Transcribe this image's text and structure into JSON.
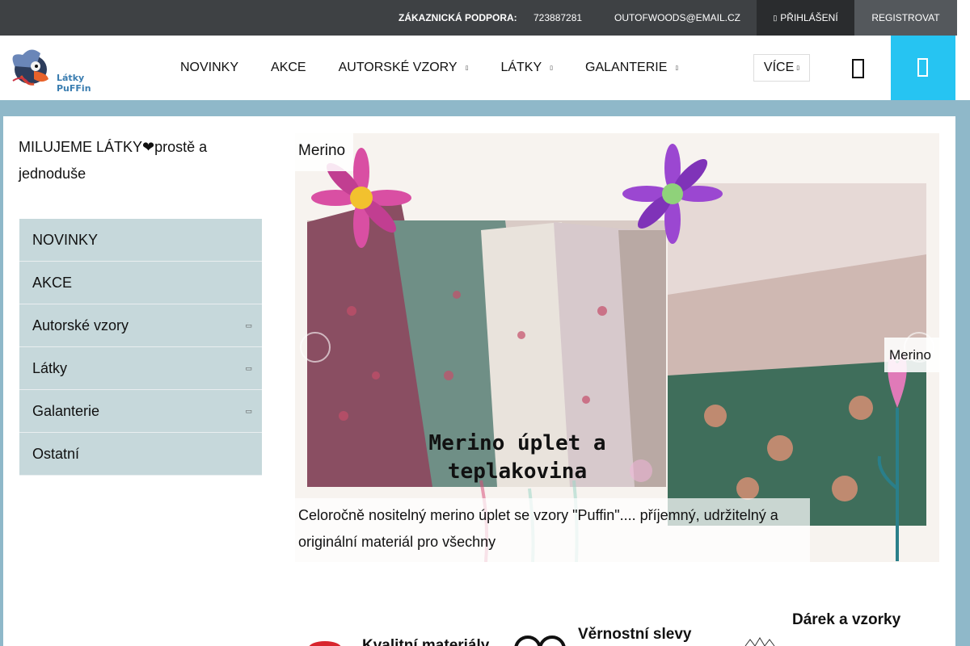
{
  "topbar": {
    "support_label": "ZÁKAZNICKÁ PODPORA:",
    "phone": "723887281",
    "email": "OUTOFWOODS@EMAIL.CZ",
    "login_label": "PŘIHLÁŠENÍ",
    "register_label": "REGISTROVAT"
  },
  "logo": {
    "text": "Látky PuFFin"
  },
  "nav": {
    "items": [
      {
        "label": "NOVINKY",
        "has_submenu": false
      },
      {
        "label": "AKCE",
        "has_submenu": false
      },
      {
        "label": "AUTORSKÉ VZORY",
        "has_submenu": true
      },
      {
        "label": "LÁTKY",
        "has_submenu": true
      },
      {
        "label": "GALANTERIE",
        "has_submenu": true
      }
    ],
    "more_label": "VÍCE"
  },
  "sidebar": {
    "welcome": "MILUJEME LÁTKY❤prostě a jednoduše",
    "items": [
      {
        "label": "NOVINKY"
      },
      {
        "label": "AKCE"
      },
      {
        "label": "Autorské vzory",
        "expander": "▭"
      },
      {
        "label": "Látky",
        "expander": "▭"
      },
      {
        "label": "Galanterie",
        "expander": "▭"
      },
      {
        "label": "Ostatní"
      }
    ]
  },
  "slider": {
    "label_left": "Merino",
    "label_right": "Merino",
    "banner_text_line1": "Merino úplet a",
    "banner_text_line2": "teplakovina",
    "caption": "Celoročně nositelný merino úplet se vzory \"Puffin\".... příjemný, udržitelný a originální materiál pro všechny"
  },
  "benefits": [
    {
      "title": "Kvalitní materiály"
    },
    {
      "title": "Věrnostní slevy"
    },
    {
      "title": "Dárek a vzorky"
    }
  ],
  "colors": {
    "topbar": "#3e4144",
    "accent_cart": "#26c4f2",
    "page_background": "#8fb8c9",
    "sidebar_item": "#c6d8db"
  }
}
